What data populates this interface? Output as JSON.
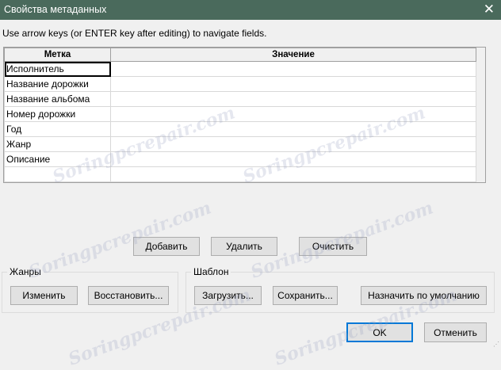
{
  "window": {
    "title": "Свойства метаданных",
    "close_icon": "close-icon"
  },
  "hint": "Use arrow keys (or ENTER key after editing) to navigate fields.",
  "table": {
    "headers": [
      "Метка",
      "Значение"
    ],
    "rows": [
      [
        "Исполнитель",
        ""
      ],
      [
        "Название дорожки",
        ""
      ],
      [
        "Название альбома",
        ""
      ],
      [
        "Номер дорожки",
        ""
      ],
      [
        "Год",
        ""
      ],
      [
        "Жанр",
        ""
      ],
      [
        "Описание",
        ""
      ],
      [
        "",
        ""
      ]
    ]
  },
  "buttons": {
    "add": "Добавить",
    "delete": "Удалить",
    "clear": "Очистить",
    "ok": "OK",
    "cancel": "Отменить"
  },
  "genres": {
    "legend": "Жанры",
    "edit": "Изменить",
    "restore": "Восстановить..."
  },
  "template": {
    "legend": "Шаблон",
    "load": "Загрузить...",
    "save": "Сохранить...",
    "set_default": "Назначить по умолчанию"
  },
  "watermark": "Soringpcrepair.com"
}
